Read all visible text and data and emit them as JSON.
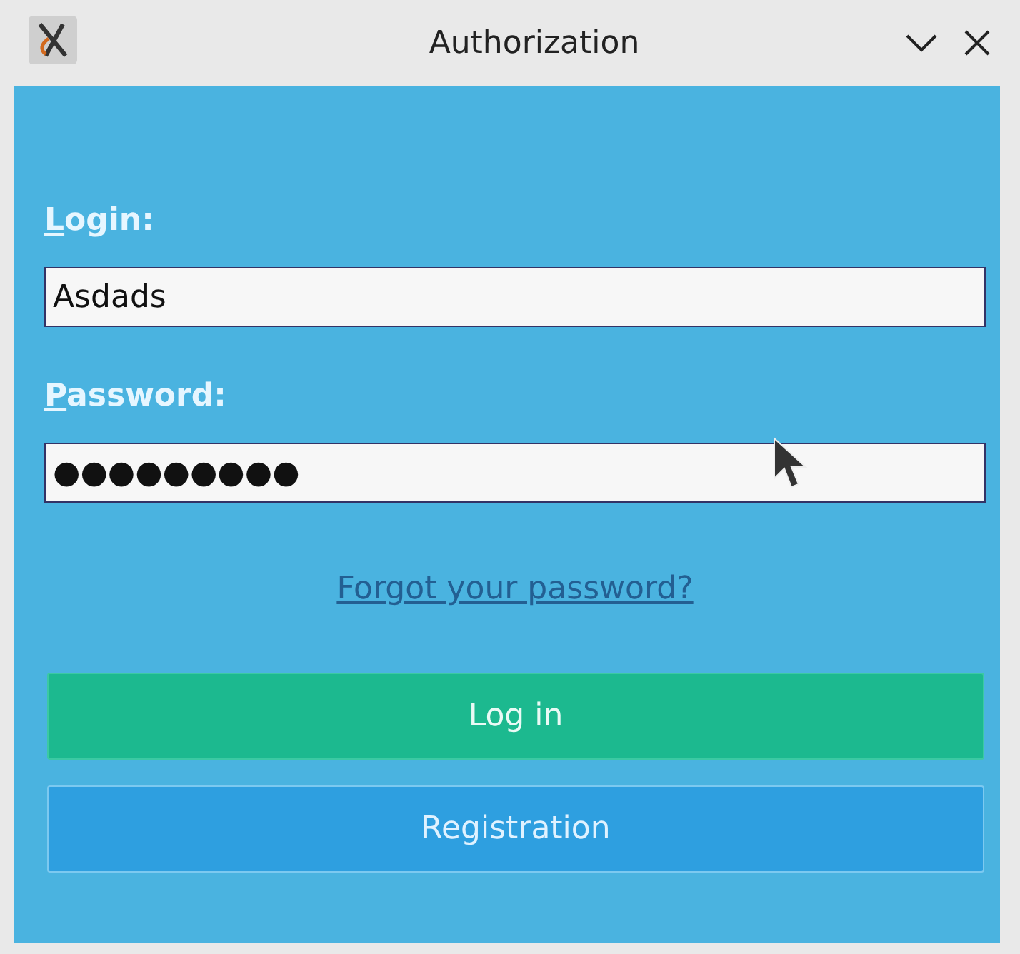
{
  "window": {
    "title": "Authorization"
  },
  "form": {
    "fields": [
      {
        "label": "Login:",
        "value": "Asdads"
      },
      {
        "label": "Password:",
        "value": "●●●●●●●●●"
      }
    ],
    "link": "Forgot your password?",
    "buttons": [
      {
        "label": "Log in",
        "kind": "primary"
      },
      {
        "label": "Registration",
        "kind": "secondary"
      }
    ]
  }
}
